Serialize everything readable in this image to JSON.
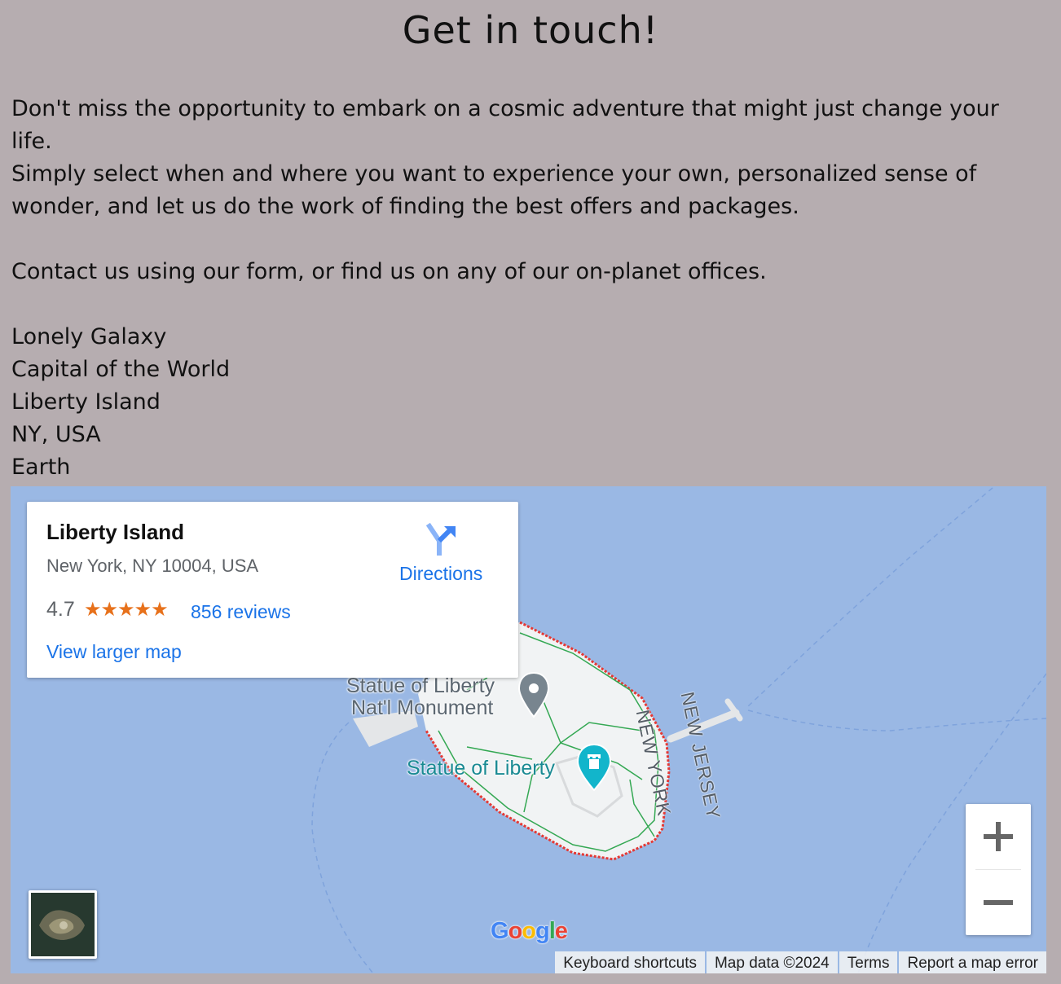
{
  "heading": "Get in touch!",
  "intro": {
    "line1": "Don't miss the opportunity to embark on a cosmic adventure that might just change your life.",
    "line2": "Simply select when and where you want to experience your own, personalized sense of wonder, and let us do the work of finding the best offers and packages.",
    "line3": "Contact us using our form, or find us on any of our on-planet offices."
  },
  "address": [
    "Lonely Galaxy",
    "Capital of the World",
    "Liberty Island",
    "NY, USA",
    "Earth"
  ],
  "map": {
    "info_card": {
      "place_name": "Liberty Island",
      "address": "New York, NY 10004, USA",
      "rating": "4.7",
      "stars": "★★★★★",
      "rating_value": 4.7,
      "reviews": "856 reviews",
      "view_larger": "View larger map",
      "directions": "Directions"
    },
    "labels": {
      "monument_line1": "Statue of Liberty",
      "monument_line2": "Nat'l Monument",
      "statue": "Statue of Liberty",
      "new_york": "NEW YORK",
      "new_jersey": "NEW JERSEY"
    },
    "zoom_in": "+",
    "zoom_out": "−",
    "logo": {
      "G": "G",
      "o1": "o",
      "o2": "o",
      "g": "g",
      "l": "l",
      "e": "e"
    },
    "attribution": [
      "Keyboard shortcuts",
      "Map data ©2024",
      "Terms",
      "Report a map error"
    ],
    "colors": {
      "water": "#9ab8e4",
      "land": "#f1f3f4",
      "paths": "#34a853",
      "border": "#e53935",
      "link": "#1a73e8",
      "star": "#e7711b"
    }
  }
}
